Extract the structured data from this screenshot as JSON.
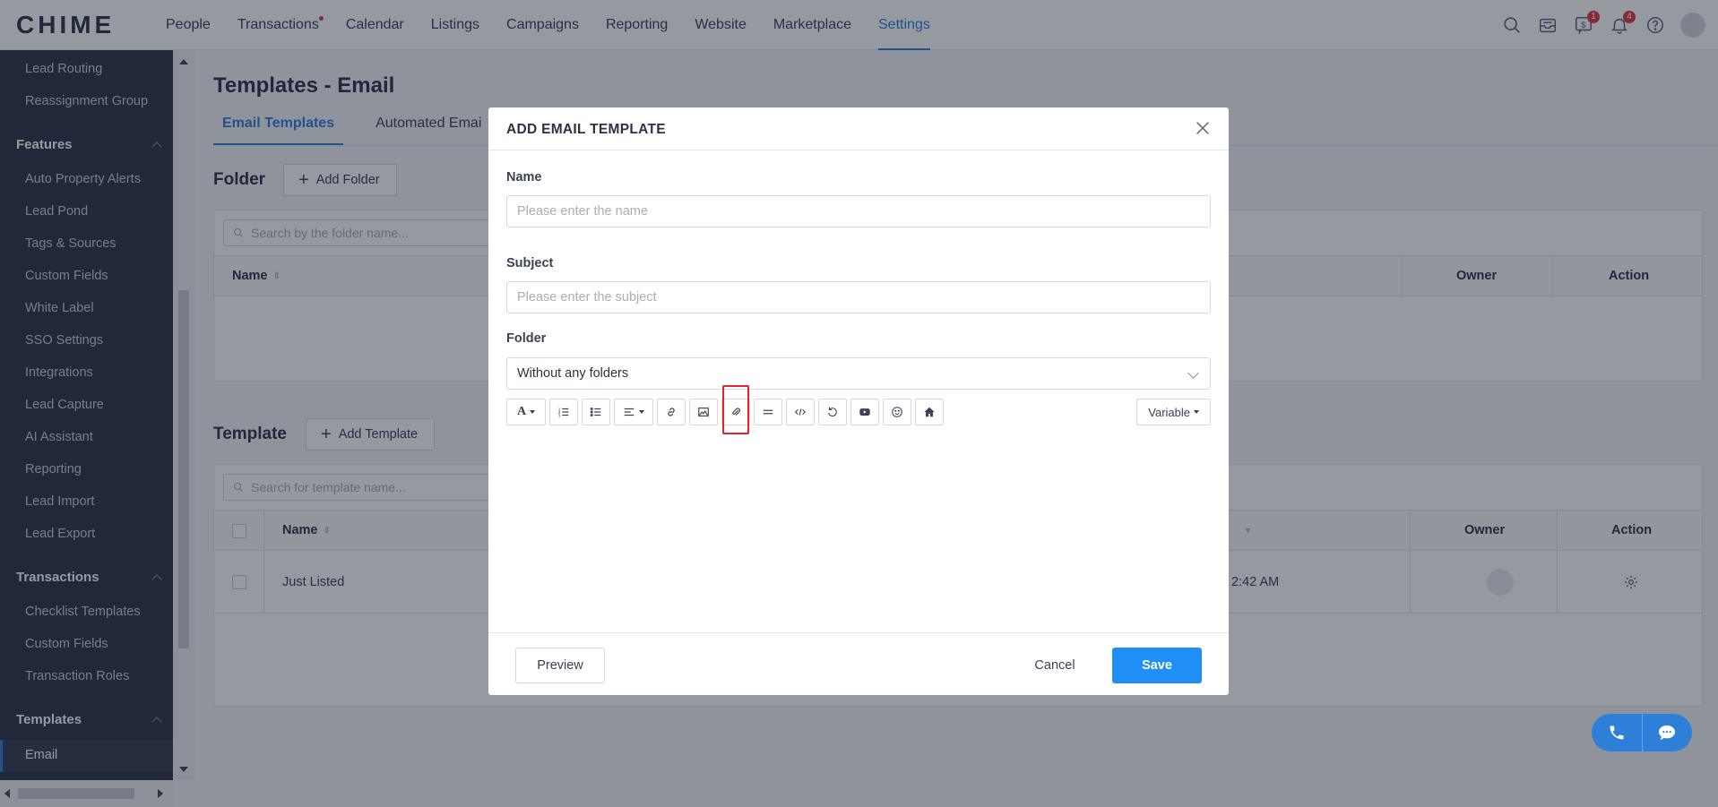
{
  "app": {
    "logo": "CHIME"
  },
  "topnav": {
    "items": [
      "People",
      "Transactions",
      "Calendar",
      "Listings",
      "Campaigns",
      "Reporting",
      "Website",
      "Marketplace",
      "Settings"
    ],
    "active": "Settings",
    "badges": {
      "calendar_alert": "1",
      "notifications": "4"
    }
  },
  "sidebar": {
    "routing_items": [
      "Lead Routing",
      "Reassignment Group"
    ],
    "features_title": "Features",
    "features_items": [
      "Auto Property Alerts",
      "Lead Pond",
      "Tags & Sources",
      "Custom Fields",
      "White Label",
      "SSO Settings",
      "Integrations",
      "Lead Capture",
      "AI Assistant",
      "Reporting",
      "Lead Import",
      "Lead Export"
    ],
    "transactions_title": "Transactions",
    "transactions_items": [
      "Checklist Templates",
      "Custom Fields",
      "Transaction Roles"
    ],
    "templates_title": "Templates",
    "templates_items": [
      "Email"
    ]
  },
  "main": {
    "title": "Templates - Email",
    "tabs": [
      "Email Templates",
      "Automated Emai"
    ],
    "folder": {
      "title": "Folder",
      "add_label": "Add Folder",
      "search_placeholder": "Search by the folder name...",
      "columns": [
        "Name",
        "Owner",
        "Action"
      ]
    },
    "template": {
      "title": "Template",
      "add_label": "Add Template",
      "search_placeholder": "Search for template name...",
      "columns": [
        "Name",
        "Owner",
        "Action"
      ],
      "rows": [
        {
          "name": "Just Listed",
          "time_fragment": "2:42 AM"
        }
      ]
    }
  },
  "modal": {
    "title": "ADD EMAIL TEMPLATE",
    "name_label": "Name",
    "name_placeholder": "Please enter the name",
    "subject_label": "Subject",
    "subject_placeholder": "Please enter the subject",
    "folder_label": "Folder",
    "folder_value": "Without any folders",
    "variable_label": "Variable",
    "preview_label": "Preview",
    "cancel_label": "Cancel",
    "save_label": "Save"
  },
  "colors": {
    "accent": "#2d7fd8",
    "save": "#1f8ff5",
    "highlight": "#e5222b",
    "sidebar": "#2b3244"
  }
}
